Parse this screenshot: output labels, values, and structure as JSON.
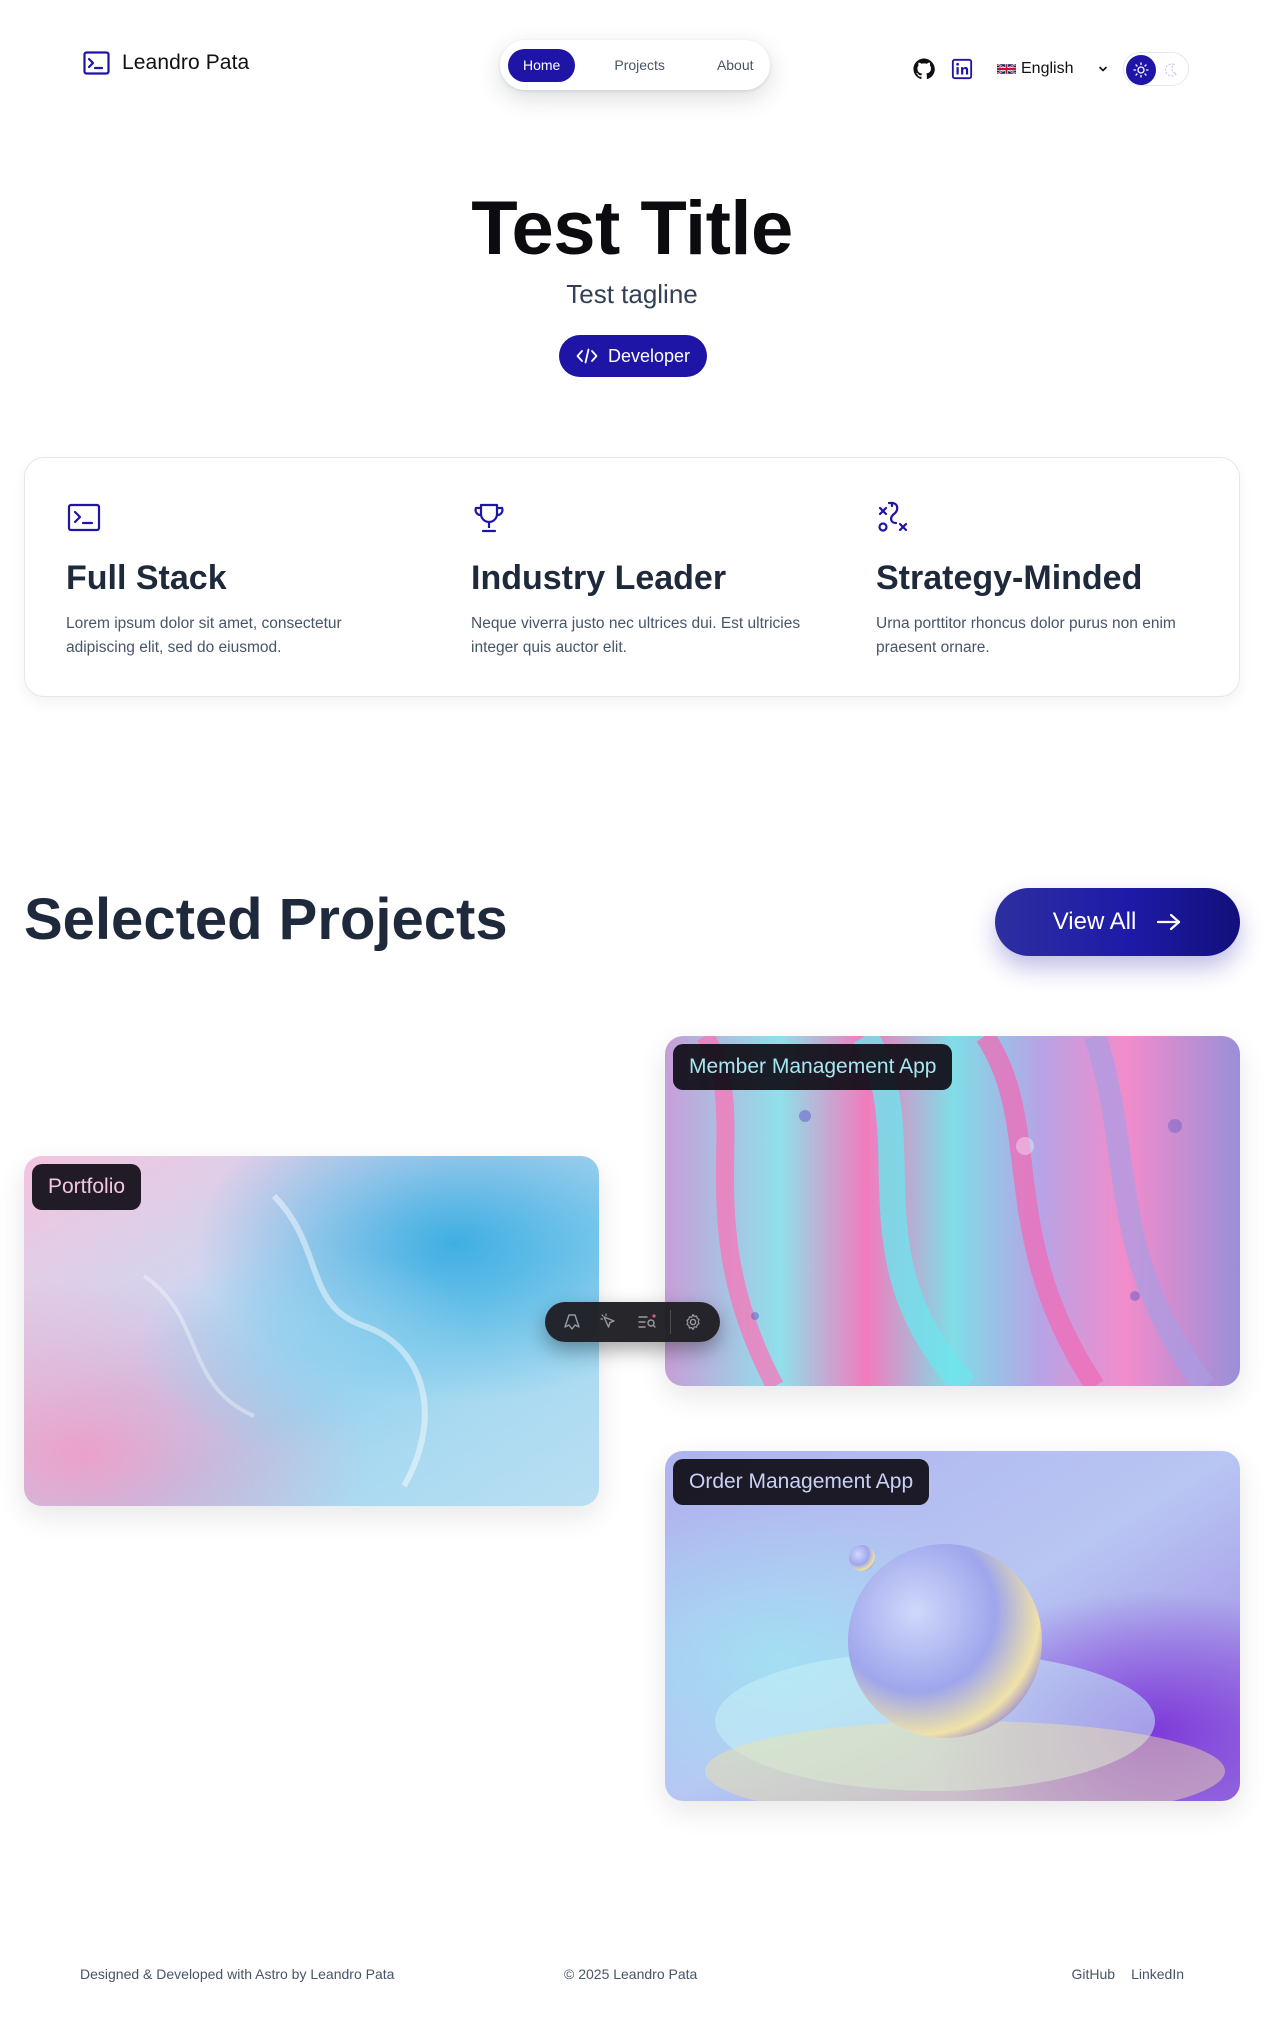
{
  "header": {
    "logo_text": "Leandro Pata",
    "nav": [
      {
        "label": "Home",
        "active": true
      },
      {
        "label": "Projects",
        "active": false
      },
      {
        "label": "About",
        "active": false
      }
    ],
    "language": {
      "flag": "🇬🇧",
      "label": "English"
    },
    "theme": "light"
  },
  "hero": {
    "title": "Test Title",
    "tagline": "Test tagline",
    "role_badge": "Developer"
  },
  "features": [
    {
      "icon": "terminal-icon",
      "title": "Full Stack",
      "description": "Lorem ipsum dolor sit amet, consectetur adipiscing elit, sed do eiusmod."
    },
    {
      "icon": "trophy-icon",
      "title": "Industry Leader",
      "description": "Neque viverra justo nec ultrices dui. Est ultricies integer quis auctor elit."
    },
    {
      "icon": "strategy-icon",
      "title": "Strategy-Minded",
      "description": "Urna porttitor rhoncus dolor purus non enim praesent ornare."
    }
  ],
  "projects": {
    "heading": "Selected Projects",
    "view_all_label": "View All",
    "items": [
      {
        "title": "Portfolio"
      },
      {
        "title": "Member Management App"
      },
      {
        "title": "Order Management App"
      }
    ]
  },
  "footer": {
    "credit": "Designed & Developed with Astro by Leandro Pata",
    "copyright": "© 2025 Leandro Pata",
    "links": [
      "GitHub",
      "LinkedIn"
    ]
  },
  "colors": {
    "accent": "#1e14a6",
    "heading": "#1e293b",
    "body_text": "#475569"
  }
}
